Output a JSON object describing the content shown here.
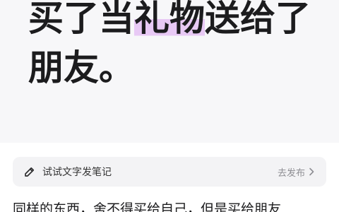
{
  "hero": {
    "line1_prefix": "买了当",
    "line1_highlight": "礼物",
    "line1_suffix": "送给了",
    "line2": "朋友。"
  },
  "note_bar": {
    "icon": "pen-icon",
    "placeholder": "试试文字发笔记",
    "publish_label": "去发布",
    "publish_icon": "chevron-right-icon"
  },
  "body": {
    "text": "同样的东西，舍不得买给自己，但是买给朋友"
  },
  "colors": {
    "highlight": "#e8c9f5",
    "hero_background": "#f7f7f9",
    "note_bar_background": "#f3f3f5"
  }
}
